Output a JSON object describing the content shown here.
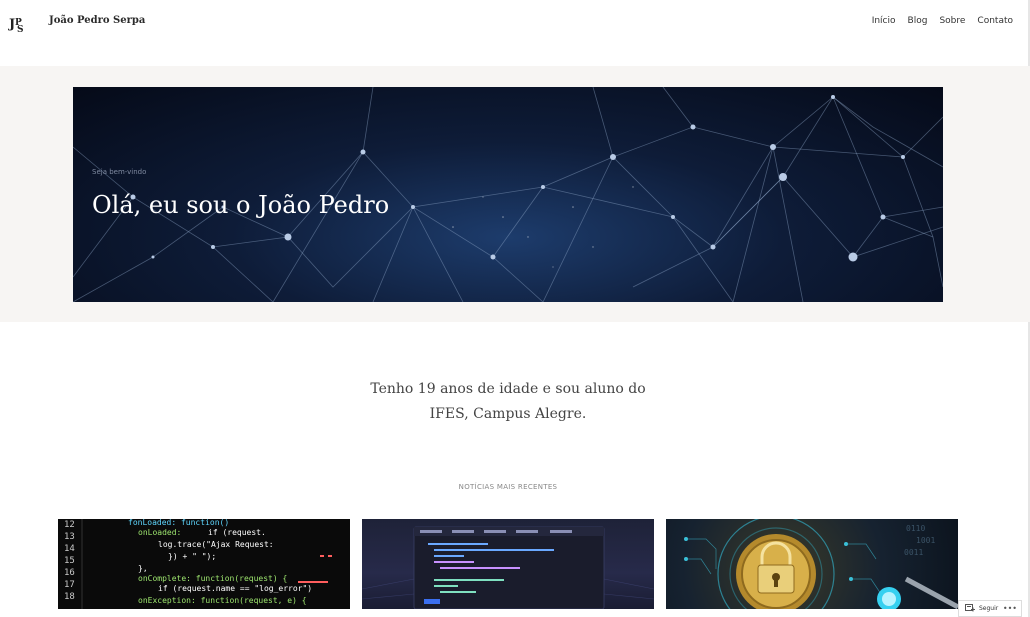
{
  "site": {
    "title": "João Pedro Serpa",
    "logo_icon": "jps-monogram-icon"
  },
  "nav": {
    "items": [
      {
        "label": "Início"
      },
      {
        "label": "Blog"
      },
      {
        "label": "Sobre"
      },
      {
        "label": "Contato"
      }
    ]
  },
  "hero": {
    "kicker": "Seja bem-vindo",
    "title": "Olá, eu sou o João Pedro",
    "background": "network-constellation-image"
  },
  "intro": {
    "line1": "Tenho 19 anos de idade e sou aluno do",
    "line2": "IFES, Campus Alegre."
  },
  "recent": {
    "label": "NOTÍCIAS MAIS RECENTES",
    "posts": [
      {
        "image": "code-editor-image"
      },
      {
        "image": "dark-ide-image"
      },
      {
        "image": "bitcoin-lock-image"
      }
    ]
  },
  "follow": {
    "label": "Seguir",
    "more": "•••"
  },
  "colors": {
    "hero_band": "#f7f5f3",
    "hero_text": "#ffffff",
    "body_text": "#444444"
  }
}
